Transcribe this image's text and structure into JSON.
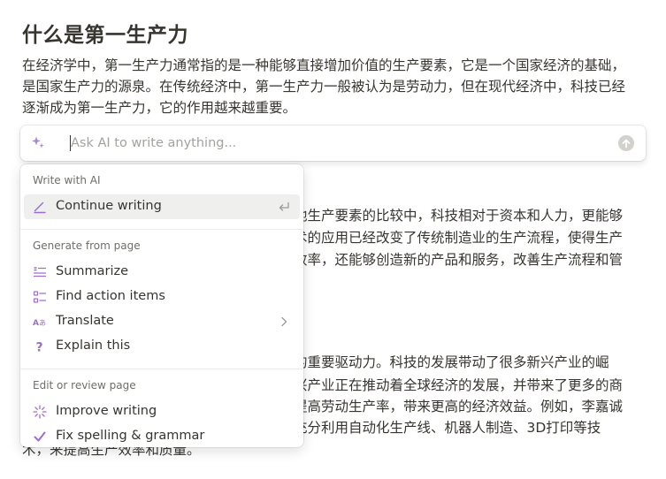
{
  "page": {
    "title": "什么是第一生产力",
    "para1_lines": [
      "在经济学中，第一生产力通常指的是一种能够直接增加价值的生产要素，它是一个国家经济的基础，",
      "是国家生产力的源泉。在传统经济中，第一生产力一般被认为是劳动力，但在现代经济中，科技已经",
      "逐渐成为第一生产力，它的作用越来越重要。"
    ],
    "bg_lines": [
      "他生产要素的比较中，科技相对于资本和人力，更能够",
      "术的应用已经改变了传统制造业的生产流程，使得生产",
      "效率，还能够创造新的产品和服务，改善生产流程和管",
      "的重要驱动力。科技的发展带动了很多新兴产业的崛",
      "兴产业正在推动着全球经济的发展，并带来了更多的商",
      "提高劳动生产率，带来更高的经济效益。例如，李嘉诚",
      "充分利用自动化生产线、机器人制造、3D打印等技",
      "术，来提高生产效率和质量。"
    ]
  },
  "ai_prompt": {
    "placeholder": "Ask AI to write anything...",
    "value": ""
  },
  "menu": {
    "sections": [
      {
        "label": "Write with AI",
        "items": [
          {
            "label": "Continue writing",
            "icon": "pen-icon",
            "right_icon": "enter-icon",
            "active": true
          }
        ]
      },
      {
        "label": "Generate from page",
        "items": [
          {
            "label": "Summarize",
            "icon": "summary-lines-icon"
          },
          {
            "label": "Find action items",
            "icon": "checklist-icon"
          },
          {
            "label": "Translate",
            "icon": "translate-icon",
            "right_icon": "chevron-right-icon"
          },
          {
            "label": "Explain this",
            "icon": "question-mark-icon"
          }
        ]
      },
      {
        "label": "Edit or review page",
        "items": [
          {
            "label": "Improve writing",
            "icon": "sparkle-burst-icon"
          },
          {
            "label": "Fix spelling & grammar",
            "icon": "checkmark-icon"
          }
        ]
      }
    ]
  },
  "colors": {
    "accent_purple": "#9b6fd0",
    "text": "#37352f",
    "muted": "#6f6e69"
  }
}
